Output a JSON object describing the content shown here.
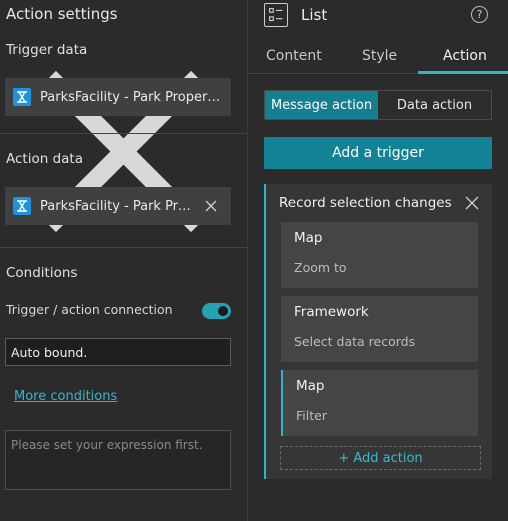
{
  "left_panel": {
    "title": "Action settings",
    "trigger_section": {
      "heading": "Trigger data",
      "data_source": "ParksFacility - Park Properties"
    },
    "action_section": {
      "heading": "Action data",
      "data_source": "ParksFacility - Park Properties"
    },
    "conditions": {
      "heading": "Conditions",
      "toggle_label": "Trigger / action connection",
      "toggle_on": true,
      "connection_value": "Auto bound.",
      "more_link": "More conditions",
      "expression_placeholder": "Please set your expression first."
    }
  },
  "right_panel": {
    "title": "List",
    "help_icon": "?",
    "tabs": [
      {
        "label": "Content",
        "active": false
      },
      {
        "label": "Style",
        "active": false
      },
      {
        "label": "Action",
        "active": true
      }
    ],
    "action_types": [
      {
        "label": "Message action",
        "selected": true
      },
      {
        "label": "Data action",
        "selected": false
      }
    ],
    "add_trigger_label": "Add a trigger",
    "trigger": {
      "title": "Record selection changes",
      "actions": [
        {
          "name": "Map",
          "description": "Zoom to"
        },
        {
          "name": "Framework",
          "description": "Select data records"
        },
        {
          "name": "Map",
          "description": "Filter"
        }
      ],
      "add_action_label": "+ Add action"
    }
  },
  "colors": {
    "accent": "#2eb5c8",
    "button": "#128394",
    "panel_bg": "#2b2b2b"
  }
}
